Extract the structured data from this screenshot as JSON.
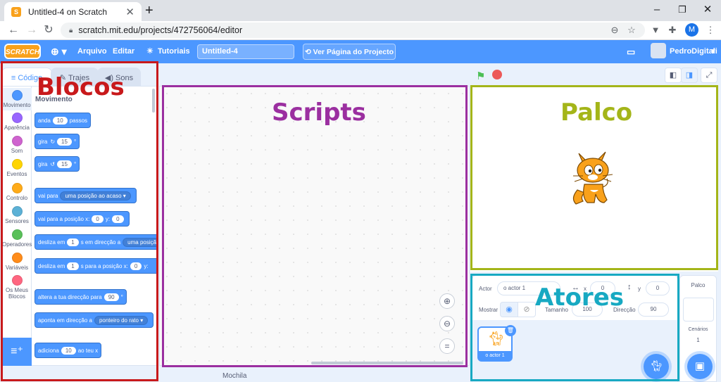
{
  "browser": {
    "tab_title": "Untitled-4 on Scratch",
    "tab_close": "✕",
    "new_tab": "+",
    "url": "scratch.mit.edu/projects/472756064/editor",
    "profile_initial": "M",
    "window_controls": [
      "–",
      "❐",
      "✕"
    ]
  },
  "menubar": {
    "logo": "SCRATCH",
    "file": "Arquivo",
    "edit": "Editar",
    "tutorials": "Tutoriais",
    "project_title": "Untitled-4",
    "see_page": "Ver Página do Projecto",
    "username": "PedroDigitali"
  },
  "editor_tabs": {
    "code": "Código",
    "costumes": "Trajes",
    "sounds": "Sons"
  },
  "categories": [
    {
      "label": "Movimento",
      "color": "#4c97ff"
    },
    {
      "label": "Aparência",
      "color": "#9966ff"
    },
    {
      "label": "Som",
      "color": "#cf63cf"
    },
    {
      "label": "Eventos",
      "color": "#ffd500"
    },
    {
      "label": "Controlo",
      "color": "#ffab19"
    },
    {
      "label": "Sensores",
      "color": "#5cb1d6"
    },
    {
      "label": "Operadores",
      "color": "#59c059"
    },
    {
      "label": "Variáveis",
      "color": "#ff8c1a"
    },
    {
      "label": "Os Meus Blocos",
      "color": "#ff6680"
    }
  ],
  "palette": {
    "heading": "Movimento",
    "blocks": {
      "move": {
        "pre": "anda",
        "val": "10",
        "post": "passos"
      },
      "turn_right": {
        "pre": "gira",
        "icon": "↻",
        "val": "15",
        "post": "°"
      },
      "turn_left": {
        "pre": "gira",
        "icon": "↺",
        "val": "15",
        "post": "°"
      },
      "goto": {
        "pre": "vai para",
        "dd": "uma posição ao acaso ▾"
      },
      "goto_xy": {
        "pre": "vai para a posição x:",
        "x": "0",
        "mid": "y:",
        "y": "0"
      },
      "glide_to": {
        "pre": "desliza em",
        "val": "1",
        "mid": "s em direcção a",
        "dd": "uma posiçã"
      },
      "glide_xy": {
        "pre": "desliza em",
        "val": "1",
        "mid": "s para a posição x:",
        "x": "0",
        "post": "y:"
      },
      "point_dir": {
        "pre": "altera a tua direcção para",
        "val": "90",
        "post": "°"
      },
      "point_towards": {
        "pre": "aponta em direcção a",
        "dd": "ponteiro do rato ▾"
      },
      "change_x": {
        "pre": "adiciona",
        "val": "10",
        "post": "ao teu x"
      }
    }
  },
  "mochila": "Mochila",
  "sprite_info": {
    "actor_label": "Actor",
    "actor_name": "o actor 1",
    "x_label": "x",
    "x_val": "0",
    "y_label": "y",
    "y_val": "0",
    "show_label": "Mostrar",
    "size_label": "Tamanho",
    "size_val": "100",
    "dir_label": "Direcção",
    "dir_val": "90"
  },
  "sprite_card": {
    "name": "o actor 1"
  },
  "stage_pane": {
    "title": "Palco",
    "backdrops_label": "Cenários",
    "backdrops_count": "1"
  },
  "annotations": {
    "blocos": {
      "text": "Blocos",
      "color": "#c8191b"
    },
    "scripts": {
      "text": "Scripts",
      "color": "#9b2fa0"
    },
    "palco": {
      "text": "Palco",
      "color": "#a4b519"
    },
    "atores": {
      "text": "Atores",
      "color": "#17a9c2"
    }
  }
}
